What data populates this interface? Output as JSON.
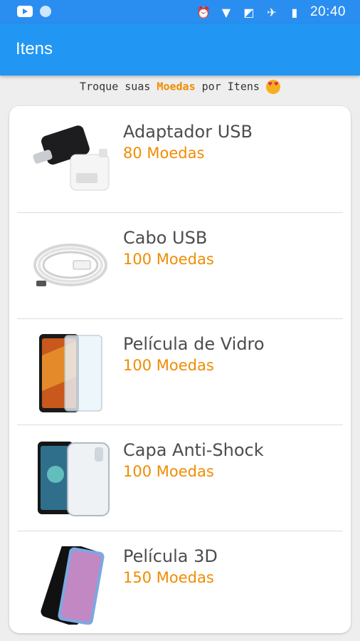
{
  "status": {
    "time": "20:40",
    "icons": [
      "youtube-icon",
      "dot-icon",
      "alarm-icon",
      "wifi-icon",
      "no-sim-icon",
      "airplane-icon",
      "battery-icon"
    ]
  },
  "appbar": {
    "title": "Itens"
  },
  "subtitle": {
    "before": "Troque suas ",
    "accent": "Moedas",
    "after": " por Itens",
    "emoji": "heart-eyes-emoji"
  },
  "items": [
    {
      "name": "Adaptador USB",
      "price": "80 Moedas",
      "image": "usb-adapter-image"
    },
    {
      "name": "Cabo USB",
      "price": "100 Moedas",
      "image": "usb-cable-image"
    },
    {
      "name": "Película de Vidro",
      "price": "100 Moedas",
      "image": "glass-film-image"
    },
    {
      "name": "Capa Anti-Shock",
      "price": "100 Moedas",
      "image": "anti-shock-case-image"
    },
    {
      "name": "Película 3D",
      "price": "150 Moedas",
      "image": "film-3d-image"
    }
  ],
  "colors": {
    "primary": "#2196f3",
    "status": "#2a8ef0",
    "accent": "#f08c00"
  }
}
